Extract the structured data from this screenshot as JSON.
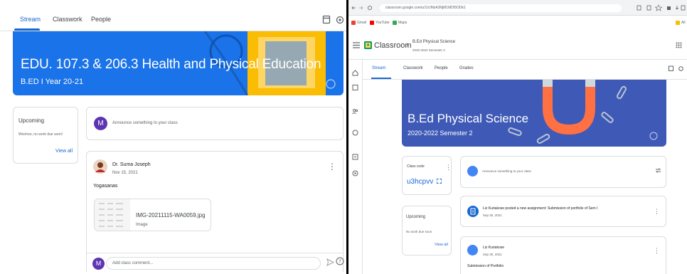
{
  "left": {
    "tabs": [
      {
        "label": "Stream",
        "active": true
      },
      {
        "label": "Classwork",
        "active": false
      },
      {
        "label": "People",
        "active": false
      }
    ],
    "banner": {
      "title": "EDU. 107.3 & 206.3 Health and Physical Education",
      "subtitle": "B.ED I Year 20-21",
      "color": "#1a73e8"
    },
    "upcoming": {
      "title": "Upcoming",
      "text": "Woohoo, no work due soon!",
      "view_all": "View all"
    },
    "announce": {
      "avatar_letter": "M",
      "placeholder": "Announce something to your class"
    },
    "post": {
      "author": "Dr. Suma Joseph",
      "date": "Nov 15, 2021",
      "body": "Yogasanas",
      "attachment_name": "IMG-20211115-WA0059.jpg",
      "attachment_type": "Image"
    },
    "comment": {
      "avatar_letter": "M",
      "placeholder": "Add class comment..."
    }
  },
  "right": {
    "url": "classroom.google.com/u/1/c/MzA3NjM1MDI5ODk1",
    "bookmarks": [
      "Gmail",
      "YouTube",
      "Maps"
    ],
    "bookmarks_more": "All",
    "app_name": "Classroom",
    "crumb": {
      "title": "B.Ed Physical Science",
      "subtitle": "2020-2022 Semester 2"
    },
    "tabs": [
      {
        "label": "Stream",
        "active": true
      },
      {
        "label": "Classwork",
        "active": false
      },
      {
        "label": "People",
        "active": false
      },
      {
        "label": "Grades",
        "active": false
      }
    ],
    "banner": {
      "title": "B.Ed Physical Science",
      "subtitle": "2020-2022 Semester 2",
      "color": "#3f5ab6"
    },
    "class_code": {
      "label": "Class code",
      "value": "u3hcpvv"
    },
    "announce": {
      "placeholder": "Announce something to your class"
    },
    "upcoming": {
      "title": "Upcoming",
      "text": "No work due soon",
      "view_all": "View all"
    },
    "posts": [
      {
        "text": "Liz Kuriakose posted a new assignment: Submission of portfolio of Sem I",
        "date": "Sep 30, 2021"
      },
      {
        "text": "Liz Kuriakose",
        "date": "Sep 30, 2021",
        "body": "Submission of Portfolio"
      }
    ]
  }
}
